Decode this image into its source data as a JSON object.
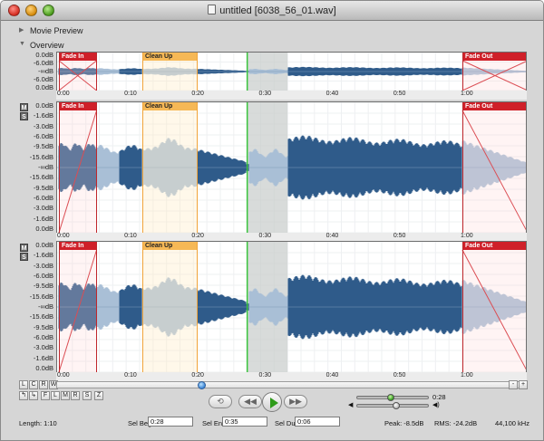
{
  "window": {
    "title": "untitled [6038_56_01.wav]"
  },
  "sections": {
    "movie_preview": "Movie Preview",
    "overview": "Overview"
  },
  "overview_axis": [
    "0.0dB",
    "-6.0dB",
    "-∞dB",
    "-6.0dB",
    "0.0dB"
  ],
  "channel_axis": [
    "0.0dB",
    "-1.6dB",
    "-3.0dB",
    "-6.0dB",
    "-9.5dB",
    "-15.6dB",
    "-∞dB",
    "-15.6dB",
    "-9.5dB",
    "-6.0dB",
    "-3.0dB",
    "-1.6dB",
    "0.0dB"
  ],
  "time_ticks": [
    "0:00",
    "0:10",
    "0:20",
    "0:30",
    "0:40",
    "0:50",
    "1:00"
  ],
  "regions": {
    "fade_in": "Fade In",
    "clean_up": "Clean Up",
    "fade_out": "Fade Out"
  },
  "mute_solo": {
    "mute": "M",
    "solo": "S"
  },
  "channel_buttons": [
    "L",
    "C",
    "R",
    "W"
  ],
  "tool_buttons": [
    "F",
    "L",
    "M",
    "R",
    "S",
    "Z"
  ],
  "zoom": {
    "minus": "-",
    "plus": "+"
  },
  "transport": {
    "loop": "loop-icon",
    "rewind": "rewind-icon",
    "play": "play-icon",
    "forward": "fast-forward-icon"
  },
  "playhead_time": "0:28",
  "playhead_fraction": 0.4667,
  "volume_fraction": 0.55,
  "status": {
    "length_label": "Length: 1:10",
    "sel_beg_label": "Sel Beg:",
    "sel_beg_value": "0:28",
    "sel_end_label": "Sel End:",
    "sel_end_value": "0:35",
    "sel_dur_label": "Sel Dur:",
    "sel_dur_value": "0:06",
    "peak": "Peak: -8.5dB",
    "rms": "RMS: -24.2dB",
    "sample_rate": "44,100 kHz"
  },
  "colors": {
    "waveform_dark": "#2f5b8a",
    "waveform_light": "#a9bfd6",
    "fade_red": "#cf2029",
    "clean_orange": "#f6b856",
    "cursor_green": "#39c43d",
    "selection_grey": "#c8cccb"
  }
}
